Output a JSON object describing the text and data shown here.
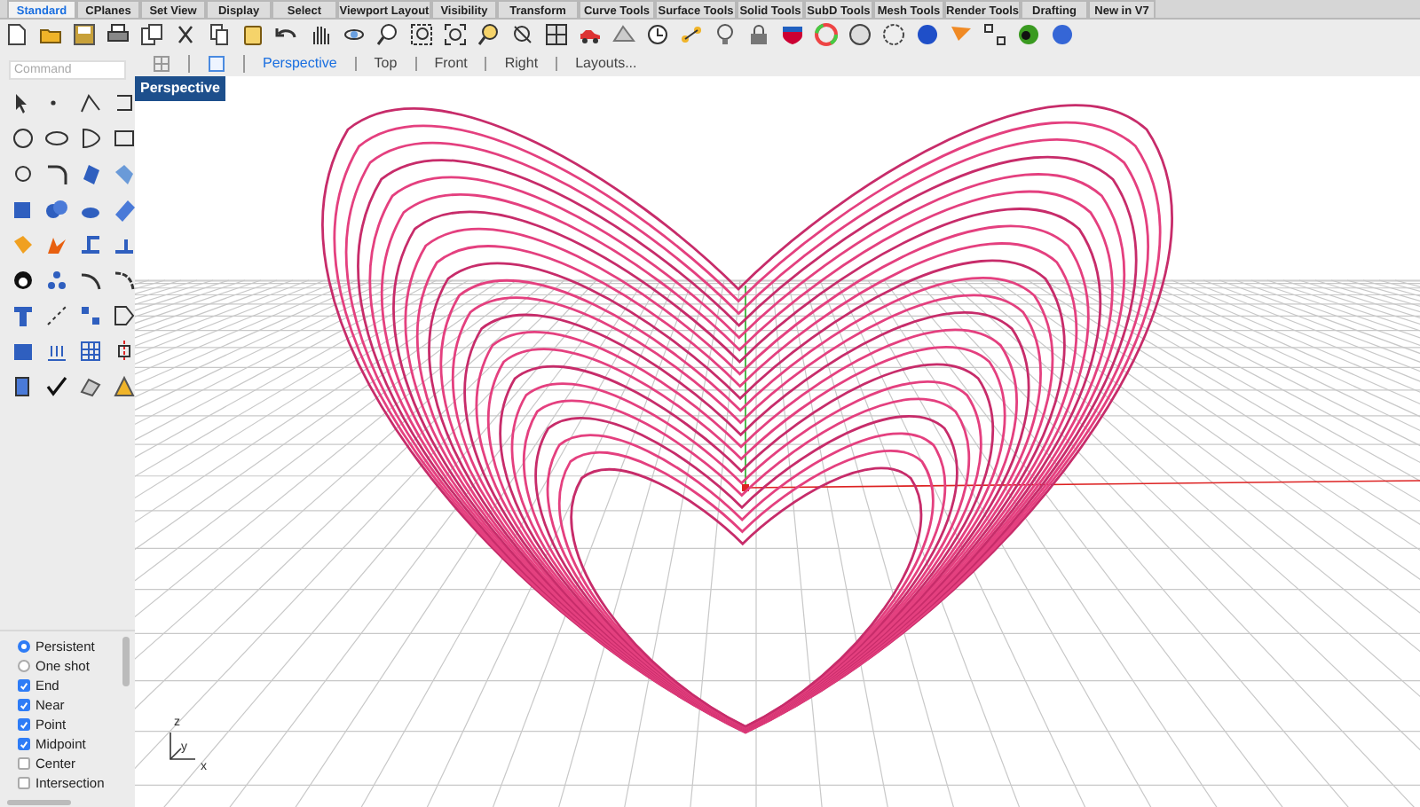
{
  "toolbar_tabs": [
    {
      "label": "Standard",
      "selected": true
    },
    {
      "label": "CPlanes",
      "selected": false
    },
    {
      "label": "Set View",
      "selected": false
    },
    {
      "label": "Display",
      "selected": false
    },
    {
      "label": "Select",
      "selected": false
    },
    {
      "label": "Viewport Layout",
      "selected": false
    },
    {
      "label": "Visibility",
      "selected": false
    },
    {
      "label": "Transform",
      "selected": false
    },
    {
      "label": "Curve Tools",
      "selected": false
    },
    {
      "label": "Surface Tools",
      "selected": false
    },
    {
      "label": "Solid Tools",
      "selected": false
    },
    {
      "label": "SubD Tools",
      "selected": false
    },
    {
      "label": "Mesh Tools",
      "selected": false
    },
    {
      "label": "Render Tools",
      "selected": false
    },
    {
      "label": "Drafting",
      "selected": false
    },
    {
      "label": "New in V7",
      "selected": false
    }
  ],
  "viewport_tabs": [
    {
      "label": "Perspective",
      "selected": true
    },
    {
      "label": "Top",
      "selected": false
    },
    {
      "label": "Front",
      "selected": false
    },
    {
      "label": "Right",
      "selected": false
    },
    {
      "label": "Layouts...",
      "selected": false
    }
  ],
  "command": {
    "placeholder": "Command"
  },
  "viewport": {
    "title": "Perspective",
    "axis_labels": [
      "z",
      "y",
      "x"
    ]
  },
  "osnap": {
    "modes": [
      {
        "label": "Persistent",
        "selected": true
      },
      {
        "label": "One shot",
        "selected": false
      }
    ],
    "snaps": [
      {
        "label": "End",
        "checked": true
      },
      {
        "label": "Near",
        "checked": true
      },
      {
        "label": "Point",
        "checked": true
      },
      {
        "label": "Midpoint",
        "checked": true
      },
      {
        "label": "Center",
        "checked": false
      },
      {
        "label": "Intersection",
        "checked": false
      }
    ]
  }
}
